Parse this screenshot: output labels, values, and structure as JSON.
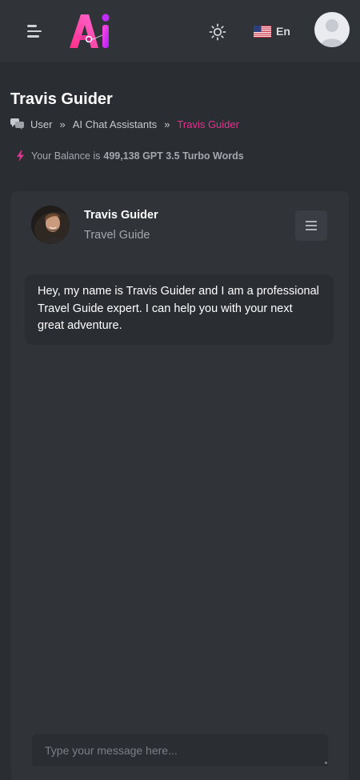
{
  "header": {
    "menu_icon": "hamburger-menu-icon",
    "logo_text": "Ai",
    "theme_icon": "sun-icon",
    "language": {
      "flag_icon": "us-flag-icon",
      "label": "En"
    },
    "user_avatar_icon": "user-avatar-icon"
  },
  "page": {
    "title": "Travis Guider",
    "breadcrumb": {
      "icon": "chat-bubbles-icon",
      "items": [
        "User",
        "AI Chat Assistants",
        "Travis Guider"
      ],
      "separator": "»"
    },
    "balance": {
      "icon": "bolt-icon",
      "prefix": "Your Balance is",
      "value": "499,138 GPT 3.5 Turbo Words"
    }
  },
  "chat": {
    "assistant": {
      "name": "Travis Guider",
      "role": "Travel Guide",
      "avatar_icon": "assistant-portrait"
    },
    "menu_icon": "list-menu-icon",
    "messages": [
      {
        "from": "assistant",
        "text": "Hey, my name is Travis Guider and I am a professional Travel Guide expert. I can help you with your next great adventure."
      }
    ],
    "input": {
      "placeholder": "Type your message here...",
      "value": ""
    }
  },
  "colors": {
    "background": "#2a2d31",
    "surface": "#303338",
    "accent": "#e0348f",
    "muted_text": "#a3a8af"
  }
}
